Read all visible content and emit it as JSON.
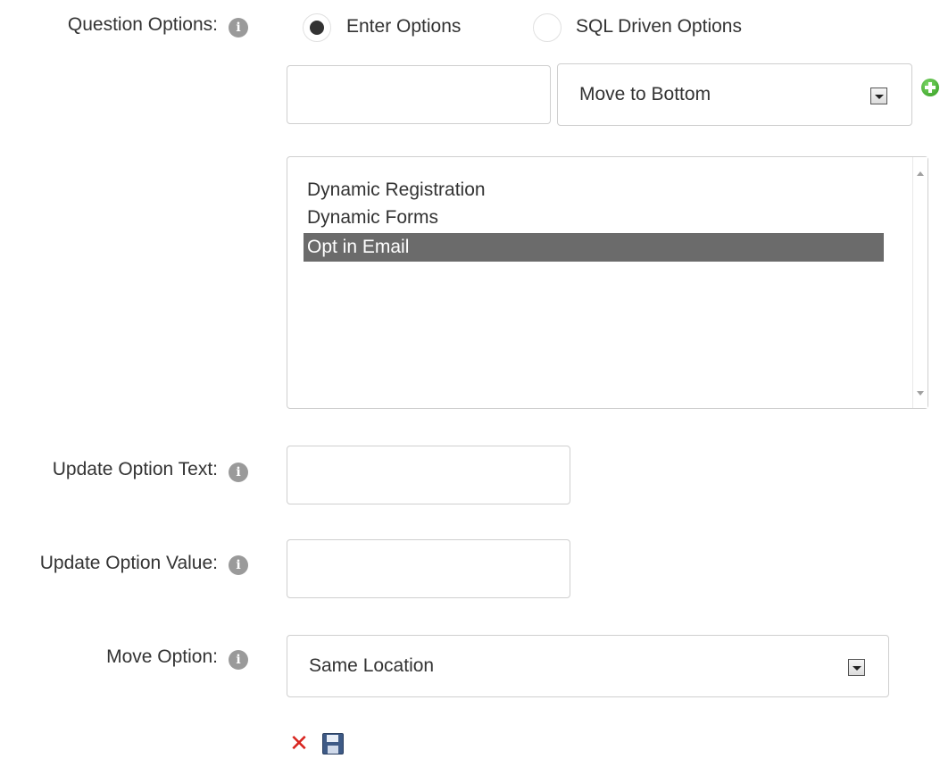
{
  "question_options": {
    "label": "Question Options:",
    "radio_enter_label": "Enter Options",
    "radio_sql_label": "SQL Driven Options",
    "selected_radio": "Enter Options",
    "new_option_value": "",
    "position_select_value": "Move to Bottom",
    "options_list": [
      {
        "text": "Dynamic Registration",
        "selected": false
      },
      {
        "text": "Dynamic Forms",
        "selected": false
      },
      {
        "text": "Opt in Email",
        "selected": true
      }
    ]
  },
  "update_option_text": {
    "label": "Update Option Text:",
    "value": ""
  },
  "update_option_value": {
    "label": "Update Option Value:",
    "value": ""
  },
  "move_option": {
    "label": "Move Option:",
    "select_value": "Same Location"
  },
  "icons": {
    "info": "info-icon",
    "add": "add-circle-icon",
    "cancel": "cancel-x-icon",
    "save": "floppy-disk-icon",
    "accent_green": "#3aa626",
    "cancel_red": "#d8251f",
    "selected_row_bg": "#6b6b6b"
  }
}
